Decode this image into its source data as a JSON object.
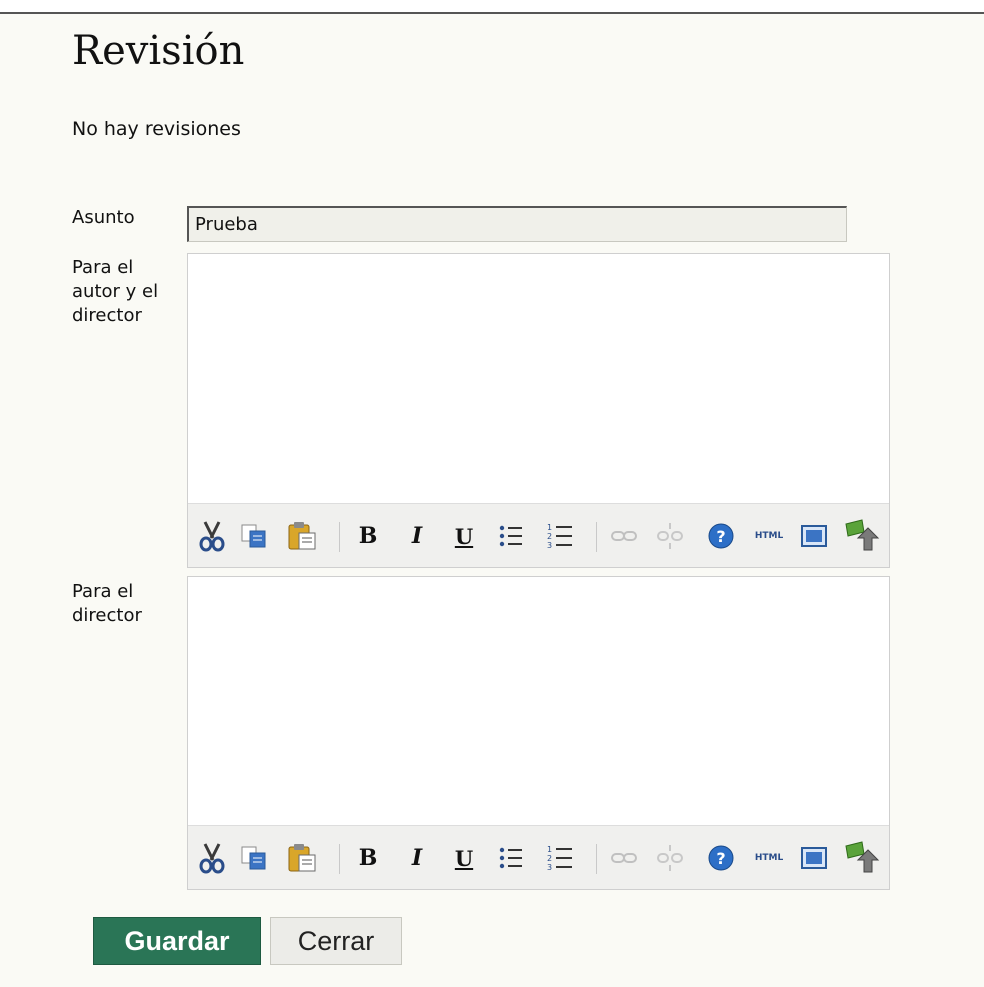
{
  "page": {
    "title": "Revisión",
    "no_reviews": "No hay revisiones"
  },
  "form": {
    "subject_label": "Asunto",
    "subject_value": "Prueba",
    "author_editor_label": "Para el autor y el director",
    "editor_label": "Para el director"
  },
  "toolbar": {
    "bold": "B",
    "italic": "I",
    "underline": "U",
    "html": "HTML"
  },
  "buttons": {
    "save": "Guardar",
    "close": "Cerrar"
  },
  "colors": {
    "save_bg": "#2a7556",
    "background": "#fafaf5"
  },
  "icons": [
    "cut-icon",
    "copy-icon",
    "paste-icon",
    "bold-icon",
    "italic-icon",
    "underline-icon",
    "bullet-list-icon",
    "numbered-list-icon",
    "link-icon",
    "unlink-icon",
    "help-icon",
    "html-icon",
    "fullscreen-icon",
    "image-upload-icon"
  ]
}
